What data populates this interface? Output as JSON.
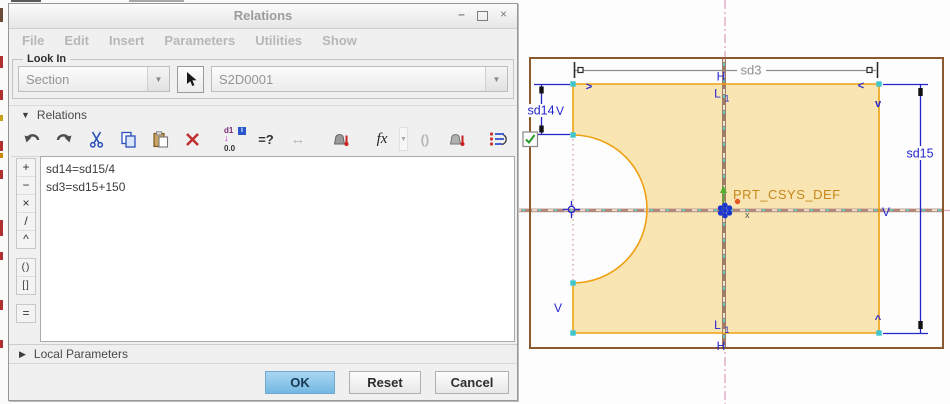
{
  "window": {
    "title": "Relations"
  },
  "icons": {
    "minimize": "–",
    "close": "×",
    "dropdown": "▼",
    "section_expanded": "▼",
    "section_collapsed": "▶",
    "measure": "↔",
    "delete": "×"
  },
  "menu": {
    "items": [
      "File",
      "Edit",
      "Insert",
      "Parameters",
      "Utilities",
      "Show"
    ]
  },
  "look_in": {
    "label": "Look In",
    "scope_value": "Section",
    "object_value": "S2D0001"
  },
  "relations_panel": {
    "header": "Relations",
    "toolbar": {
      "dim_switch_top": "d1",
      "dim_switch_bottom": "0.0",
      "info_badge": "i",
      "evaluate": "=?",
      "function": "fx",
      "parens": "()"
    },
    "operators": {
      "plus": "+",
      "minus": "−",
      "multiply": "×",
      "divide": "/",
      "power": "^",
      "parens": "()",
      "brackets": "[]",
      "equals": "="
    },
    "relations": [
      "sd14=sd15/4",
      "sd3=sd15+150"
    ]
  },
  "local_parameters": {
    "header": "Local Parameters"
  },
  "footer": {
    "ok": "OK",
    "reset": "Reset",
    "cancel": "Cancel"
  },
  "sketch": {
    "csys_label": "PRT_CSYS_DEF",
    "axis_x_label": "x",
    "dims": {
      "sd3": "sd3",
      "sd14": "sd14",
      "sd15": "sd15"
    },
    "constraints": {
      "h_top": "H",
      "l_top": "L",
      "l_top_sub": "1",
      "l_bottom": "L",
      "l_bottom_sub": "1",
      "h_bottom": "H",
      "v_left_upper": "V",
      "v_left_lower": "V",
      "v_right": "V",
      "arrow_right_cw": ">",
      "arrow_left_cw": "<",
      "arrow_down": "v",
      "arrow_up": "^"
    },
    "colors": {
      "outline": "#efa012",
      "fill": "#f8e5b2",
      "dimension_blue": "#2424cc",
      "driven_dim_gray": "#8f8f8f",
      "datum_border": "#8a5a2e",
      "centerline_pink": "#e2a2c0",
      "vertex_cyan": "#3fc6cc",
      "csys_label": "#c8861c"
    }
  }
}
